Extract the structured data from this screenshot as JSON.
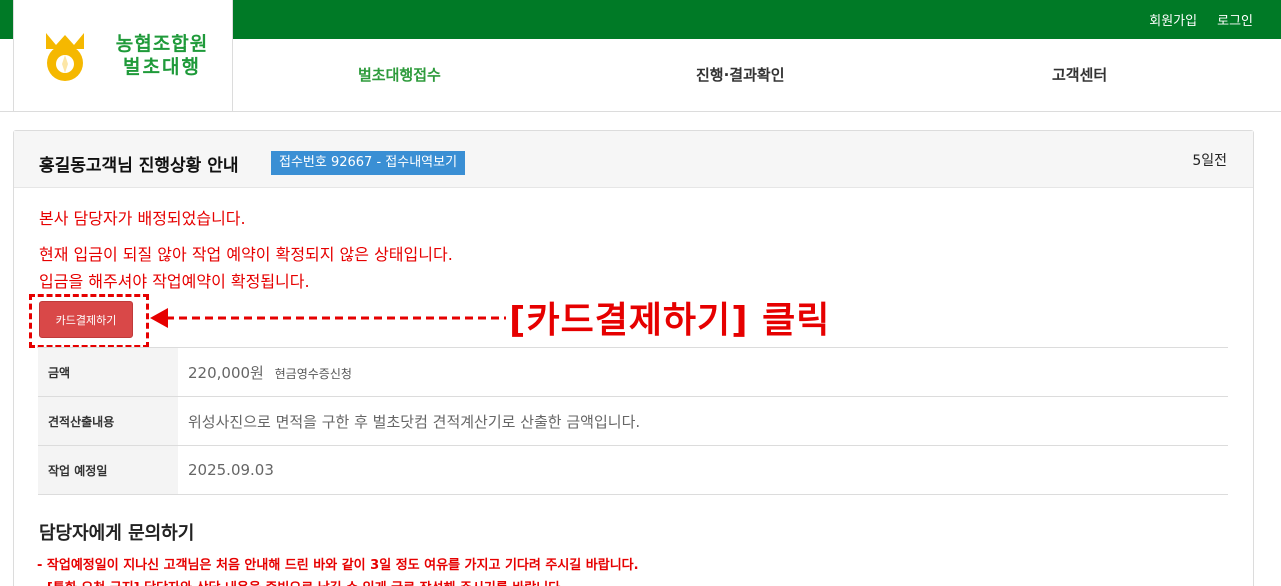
{
  "top_links": [
    "회원가입",
    "로그인"
  ],
  "logo": {
    "line1": "농협조합원",
    "line2": "벌초대행"
  },
  "nav": [
    "벌초대행접수",
    "진행·결과확인",
    "고객센터"
  ],
  "panel": {
    "title": "홍길동고객님 진행상황 안내",
    "receipt_badge": "접수번호 92667 - 접수내역보기",
    "days_left": "5일전"
  },
  "messages": [
    "본사 담당자가 배정되었습니다.",
    "현재 입금이 되질 않아 작업 예약이 확정되지 않은 상태입니다.",
    "입금을 해주셔야 작업예약이 확정됩니다."
  ],
  "card_pay_button": "카드결제하기",
  "annotation": "[카드결제하기] 클릭",
  "info": {
    "amount_label": "금액",
    "amount_value": "220,000원",
    "amount_sub": "현금영수증신청",
    "estimate_label": "견적산출내용",
    "estimate_value": "위성사진으로 면적을 구한 후 벌초닷컴 견적계산기로 산출한 금액입니다.",
    "date_label": "작업 예정일",
    "date_value": "2025.09.03"
  },
  "inquiry": {
    "title": "담당자에게 문의하기",
    "notices": [
      "- 작업예정일이 지나신 고객님은 처음 안내해 드린 바와 같이 3일 정도 여유를 가지고 기다려 주시길 바랍니다.",
      "- [통화 요청 금지] 담당자와 상담 내용을 증빙으로 남길 수 있게 글로 작성해 주시기를 바랍니다."
    ]
  },
  "colors": {
    "brand_green": "#007a26",
    "alert_red": "#e60000",
    "badge_blue": "#3a8fd4"
  },
  "icons": [
    "nh-logo-icon",
    "arrow-left-icon"
  ]
}
